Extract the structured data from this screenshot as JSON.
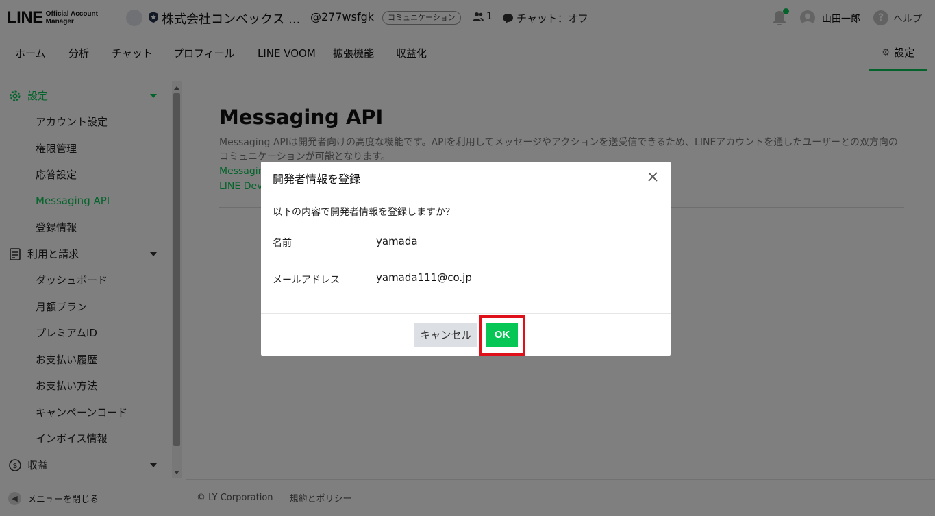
{
  "header": {
    "logo_main": "LINE",
    "logo_sub_1": "Official Account",
    "logo_sub_2": "Manager",
    "account_name": "株式会社コンベックス ...",
    "account_id": "@277wsfgk",
    "account_plan_badge": "コミュニケーション",
    "follower_count": "1",
    "chat_status": "チャット：オフ",
    "user_name": "山田一郎",
    "help_label": "ヘルプ",
    "notification_dot_color": "#06c755"
  },
  "nav": {
    "tabs": [
      {
        "label": "ホーム"
      },
      {
        "label": "分析"
      },
      {
        "label": "チャット"
      },
      {
        "label": "プロフィール"
      },
      {
        "label": "LINE VOOM"
      },
      {
        "label": "拡張機能"
      },
      {
        "label": "収益化"
      }
    ],
    "settings_label": "設定"
  },
  "sidebar": {
    "groups": [
      {
        "label": "設定",
        "icon": "gear-icon",
        "active": true,
        "items": [
          {
            "label": "アカウント設定"
          },
          {
            "label": "権限管理"
          },
          {
            "label": "応答設定"
          },
          {
            "label": "Messaging API",
            "active": true
          },
          {
            "label": "登録情報"
          }
        ]
      },
      {
        "label": "利用と請求",
        "icon": "document-icon",
        "items": [
          {
            "label": "ダッシュボード"
          },
          {
            "label": "月額プラン"
          },
          {
            "label": "プレミアムID"
          },
          {
            "label": "お支払い履歴"
          },
          {
            "label": "お支払い方法"
          },
          {
            "label": "キャンペーンコード"
          },
          {
            "label": "インボイス情報"
          }
        ]
      },
      {
        "label": "収益",
        "icon": "dollar-icon",
        "items": []
      }
    ],
    "close_menu_label": "メニューを閉じる"
  },
  "main": {
    "title": "Messaging API",
    "description": "Messaging APIは開発者向けの高度な機能です。APIを利用してメッセージやアクションを送受信できるため、LINEアカウントを通したユーザーとの双方向のコミュニケーションが可能となります。",
    "link_1": "Messagin",
    "link_2": "LINE Dev"
  },
  "footer": {
    "copyright": "© LY Corporation",
    "policy_link": "規約とポリシー"
  },
  "modal": {
    "title": "開発者情報を登録",
    "question": "以下の内容で開発者情報を登録しますか？",
    "fields": [
      {
        "label": "名前",
        "value": "yamada"
      },
      {
        "label": "メールアドレス",
        "value": "yamada111@co.jp"
      }
    ],
    "cancel_label": "キャンセル",
    "ok_label": "OK",
    "accent_color": "#06c755",
    "highlight_color": "#e0101a"
  }
}
